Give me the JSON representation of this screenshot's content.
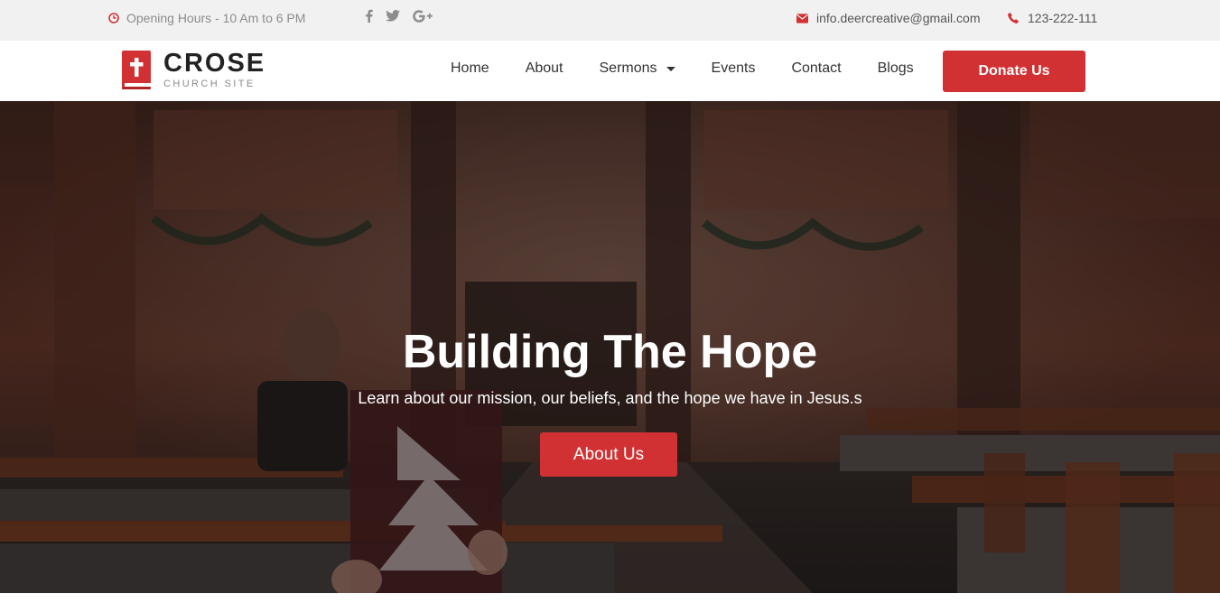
{
  "topbar": {
    "hours": "Opening Hours - 10 Am to 6 PM",
    "email": "info.deercreative@gmail.com",
    "phone": "123-222-111",
    "icons": [
      "clock-icon",
      "facebook-icon",
      "twitter-icon",
      "google-plus-icon",
      "envelope-icon",
      "phone-icon"
    ]
  },
  "brand": {
    "name": "CROSE",
    "tagline": "CHURCH SITE",
    "icon": "bible-cross-icon"
  },
  "nav": {
    "items": [
      {
        "label": "Home"
      },
      {
        "label": "About"
      },
      {
        "label": "Sermons",
        "has_dropdown": true
      },
      {
        "label": "Events"
      },
      {
        "label": "Contact"
      },
      {
        "label": "Blogs"
      }
    ],
    "donate_label": "Donate Us"
  },
  "hero": {
    "title": "Building The Hope",
    "subtitle": "Learn about our mission, our beliefs, and the hope we have in Jesus.s",
    "button_label": "About Us"
  },
  "colors": {
    "accent": "#d23133",
    "topbar_bg": "#f1f1f1",
    "text_dark": "#333333",
    "text_muted": "#8c8c8c"
  }
}
